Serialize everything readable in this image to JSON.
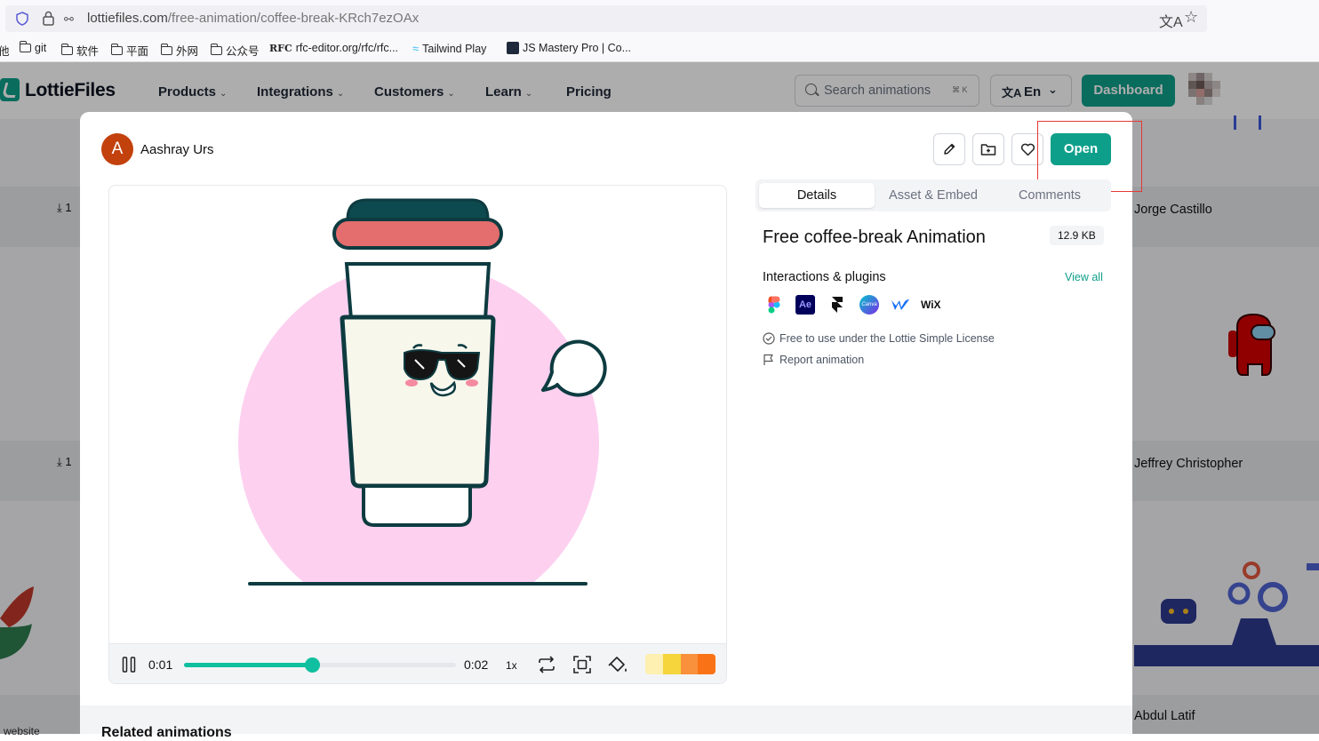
{
  "browser": {
    "url_domain": "lottiefiles.com",
    "url_path": "/free-animation/coffee-break-KRch7ezOAx",
    "bookmarks": [
      {
        "label": "他",
        "icon": "none"
      },
      {
        "label": "git",
        "icon": "folder-icon"
      },
      {
        "label": "软件",
        "icon": "folder-icon"
      },
      {
        "label": "平面",
        "icon": "folder-icon"
      },
      {
        "label": "外网",
        "icon": "folder-icon"
      },
      {
        "label": "公众号",
        "icon": "folder-icon"
      },
      {
        "label": "rfc-editor.org/rfc/rfc...",
        "icon": "rfc-icon"
      },
      {
        "label": "Tailwind Play",
        "icon": "tailwind-icon"
      },
      {
        "label": "JS Mastery Pro | Co...",
        "icon": "jsm-icon"
      }
    ]
  },
  "site": {
    "logo": "LottieFiles",
    "nav": [
      {
        "label": "Products"
      },
      {
        "label": "Integrations"
      },
      {
        "label": "Customers"
      },
      {
        "label": "Learn"
      },
      {
        "label": "Pricing"
      }
    ],
    "search_placeholder": "Search animations",
    "search_shortcut": "⌘ K",
    "lang": "En",
    "dashboard": "Dashboard",
    "accent": "#0e9f8a"
  },
  "gallery": {
    "right_authors": [
      "Jorge Castillo",
      "Jeffrey Christopher",
      "Abdul Latif"
    ],
    "left_counts": [
      "1",
      "1"
    ],
    "bottom_left_text": "website"
  },
  "modal": {
    "author_initial": "A",
    "author_name": "Aashray Urs",
    "actions": [
      "pencil-icon",
      "folder-plus-icon",
      "heart-icon"
    ],
    "open_label": "Open",
    "player": {
      "current_time": "0:01",
      "total_time": "0:02",
      "speed": "1x",
      "progress": 0.47,
      "palette": [
        "#fdf0b0",
        "#f5d53b",
        "#f9903b",
        "#f97316"
      ]
    },
    "tabs": [
      {
        "label": "Details",
        "active": true
      },
      {
        "label": "Asset & Embed",
        "active": false
      },
      {
        "label": "Comments",
        "active": false
      }
    ],
    "title": "Free coffee-break Animation",
    "file_size": "12.9 KB",
    "interactions_label": "Interactions & plugins",
    "view_all": "View all",
    "plugins": [
      "figma-icon",
      "after-effects-icon",
      "framer-icon",
      "canva-icon",
      "webflow-icon",
      "wix-icon"
    ],
    "plugin_texts": {
      "ae": "Ae",
      "canva": "Canva",
      "wix": "WiX"
    },
    "license": "Free to use under the Lottie Simple License",
    "report": "Report animation",
    "related": "Related animations"
  }
}
